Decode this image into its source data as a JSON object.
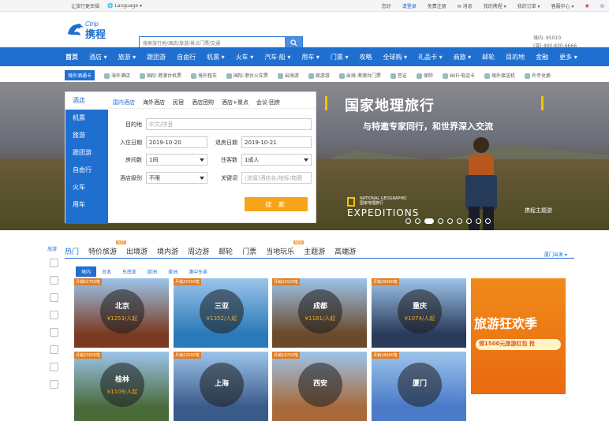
{
  "topbar": {
    "slogan": "让旅行更幸福",
    "language": "Language",
    "greeting": "您好",
    "login": "请登录",
    "register": "免费注册",
    "messages": "消息",
    "my_trips": "我的携程",
    "my_orders": "我的订单",
    "help": "客服中心"
  },
  "header": {
    "logo_text": "携程",
    "logo_en": "Ctrip",
    "search_placeholder": "搜索旅行地/酒店/旅游/景点门票/交通",
    "hotline_label1": "境内: 95010",
    "hotline_label2": "(或) 400-830-6666"
  },
  "nav": {
    "items": [
      "首页",
      "酒店 ▾",
      "旅游 ▾",
      "跟团游",
      "自由行",
      "机票 ▾",
      "火车 ▾",
      "汽车·船 ▾",
      "用车 ▾",
      "门票 ▾",
      "攻略",
      "全球购 ▾",
      "礼品卡 ▾",
      "商旅 ▾",
      "邮轮",
      "目的地",
      "金融",
      "更多 ▾"
    ]
  },
  "subnav": {
    "tag": "境外酒通卡",
    "items": [
      "海外酒店",
      "国际·港澳台机票",
      "境外租车",
      "国际·港台火车票",
      "出境游",
      "周游游",
      "出境·港澳台门票",
      "签证",
      "保险",
      "WiFi·电话卡",
      "境外接送机",
      "外币兑换"
    ]
  },
  "banner": {
    "title": "国家地理旅行",
    "subtitle": "与特邀专家同行，和世界深入交流",
    "expeditions": "EXPEDITIONS",
    "ng_text": "NATIONAL GEOGRAPHIC",
    "ng_cn": "国家地理旅行",
    "brand": "携程主题游"
  },
  "booking": {
    "side": [
      "酒店",
      "机票",
      "旅游",
      "跟团游",
      "自由行",
      "火车",
      "用车"
    ],
    "tabs": [
      "国内酒店",
      "海外酒店",
      "民宿",
      "酒店团购",
      "酒店+景点",
      "会议·团房"
    ],
    "dest_label": "目的地",
    "dest_placeholder": "中文/拼音",
    "checkin_label": "入住日期",
    "checkin": "2019-10-20",
    "checkout_label": "退房日期",
    "checkout": "2019-10-21",
    "rooms_label": "房间数",
    "rooms": "1间",
    "guests_label": "住客数",
    "guests": "1成人",
    "level_label": "酒店级别",
    "level": "不限",
    "keyword_label": "关键词",
    "keyword_placeholder": "(选填)酒店名/地标/商圈",
    "search_btn": "搜 索"
  },
  "tours": {
    "side_title": "旅游",
    "tabs": [
      {
        "label": "热门",
        "badge": ""
      },
      {
        "label": "特价旅游",
        "badge": "HOT"
      },
      {
        "label": "出境游",
        "badge": ""
      },
      {
        "label": "境内游",
        "badge": ""
      },
      {
        "label": "周边游",
        "badge": ""
      },
      {
        "label": "邮轮",
        "badge": ""
      },
      {
        "label": "门票",
        "badge": ""
      },
      {
        "label": "当地玩乐",
        "badge": "NEW"
      },
      {
        "label": "主题游",
        "badge": ""
      },
      {
        "label": "高端游",
        "badge": ""
      }
    ],
    "depart": "厦门出发 ▾",
    "regions": [
      "境内",
      "日本",
      "东南亚",
      "欧洲",
      "美洲",
      "澳中东非"
    ],
    "cards": [
      {
        "city": "北京",
        "tag": "月销52700笔",
        "price": "¥1253/人起",
        "color": "#7a3a22"
      },
      {
        "city": "三亚",
        "tag": "月销37200笔",
        "price": "¥1352/人起",
        "color": "#2a7ab8"
      },
      {
        "city": "成都",
        "tag": "月销23100笔",
        "price": "¥1181/人起",
        "color": "#6a4a2a"
      },
      {
        "city": "重庆",
        "tag": "月销29000笔",
        "price": "¥1074/人起",
        "color": "#2a3a5a"
      },
      {
        "city": "桂林",
        "tag": "月销23500笔",
        "price": "¥1109/人起",
        "color": "#4a6a3a"
      },
      {
        "city": "上海",
        "tag": "月销22600笔",
        "price": "",
        "color": "#3a5a8a"
      },
      {
        "city": "西安",
        "tag": "月销19700笔",
        "price": "",
        "color": "#a86a3a"
      },
      {
        "city": "厦门",
        "tag": "月销18600笔",
        "price": "",
        "color": "#4a7ac8"
      }
    ],
    "promo_title": "旅游狂欢季",
    "promo_sub": "领1500元旅游红包 抢"
  }
}
